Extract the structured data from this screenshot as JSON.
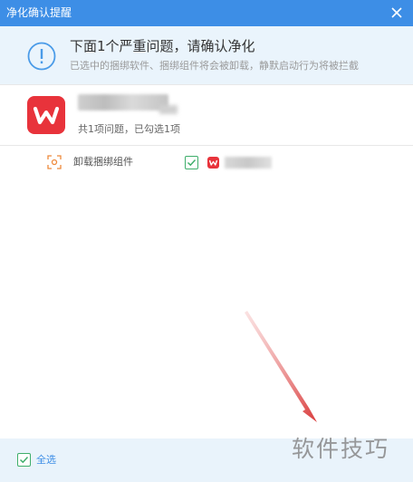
{
  "window": {
    "title": "净化确认提醒"
  },
  "header": {
    "headline": "下面1个严重问题，请确认净化",
    "subline": "已选中的捆绑软件、捆绑组件将会被卸载，静默启动行为将被拦截"
  },
  "app": {
    "summary": "共1项问题，已勾选1项"
  },
  "item": {
    "label": "卸载捆绑组件",
    "checked": true
  },
  "footer": {
    "select_all_label": "全选",
    "checked": true
  },
  "watermark": "软件技巧",
  "colors": {
    "titlebar": "#3d8ee6",
    "accent_green": "#3fae6b",
    "wps_red": "#e8333b",
    "arrow_red": "#d93b3b"
  }
}
